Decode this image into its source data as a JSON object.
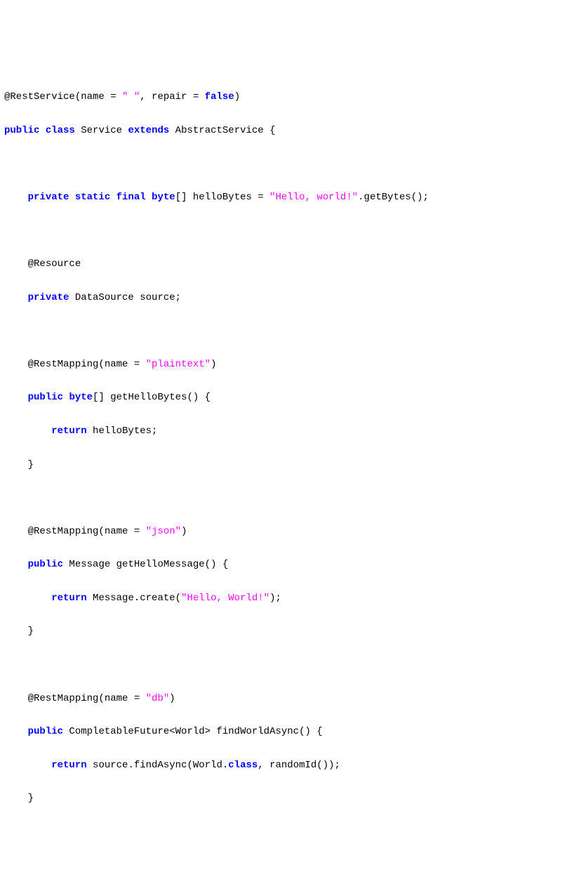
{
  "code": {
    "line1": {
      "at": "@RestService(name = ",
      "str1": "\" \"",
      "mid": ", repair = ",
      "kw_false": "false",
      "end": ")"
    },
    "line2": {
      "kw_public": "public",
      "sp1": " ",
      "kw_class": "class",
      "sp2": " Service ",
      "kw_extends": "extends",
      "rest": " AbstractService {"
    },
    "line4": {
      "indent": "    ",
      "kw_private": "private",
      "sp1": " ",
      "kw_static": "static",
      "sp2": " ",
      "kw_final": "final",
      "sp3": " ",
      "kw_byte": "byte",
      "rest1": "[] helloBytes = ",
      "str": "\"Hello, world!\"",
      "rest2": ".getBytes();"
    },
    "line6": {
      "indent": "    ",
      "text": "@Resource"
    },
    "line7": {
      "indent": "    ",
      "kw_private": "private",
      "rest": " DataSource source;"
    },
    "line9": {
      "indent": "    ",
      "text1": "@RestMapping(name = ",
      "str": "\"plaintext\"",
      "text2": ")"
    },
    "line10": {
      "indent": "    ",
      "kw_public": "public",
      "sp": " ",
      "kw_byte": "byte",
      "rest": "[] getHelloBytes() {"
    },
    "line11": {
      "indent": "        ",
      "kw_return": "return",
      "rest": " helloBytes;"
    },
    "line12": {
      "indent": "    ",
      "text": "}"
    },
    "line14": {
      "indent": "    ",
      "text1": "@RestMapping(name = ",
      "str": "\"json\"",
      "text2": ")"
    },
    "line15": {
      "indent": "    ",
      "kw_public": "public",
      "rest": " Message getHelloMessage() {"
    },
    "line16": {
      "indent": "        ",
      "kw_return": "return",
      "rest1": " Message.create(",
      "str": "\"Hello, World!\"",
      "rest2": ");"
    },
    "line17": {
      "indent": "    ",
      "text": "}"
    },
    "line19": {
      "indent": "    ",
      "text1": "@RestMapping(name = ",
      "str": "\"db\"",
      "text2": ")"
    },
    "line20": {
      "indent": "    ",
      "kw_public": "public",
      "rest": " CompletableFuture<World> findWorldAsync() {"
    },
    "line21": {
      "indent": "        ",
      "kw_return": "return",
      "rest1": " source.findAsync(World.",
      "kw_class": "class",
      "rest2": ", randomId());"
    },
    "line22": {
      "indent": "    ",
      "text": "}"
    }
  }
}
